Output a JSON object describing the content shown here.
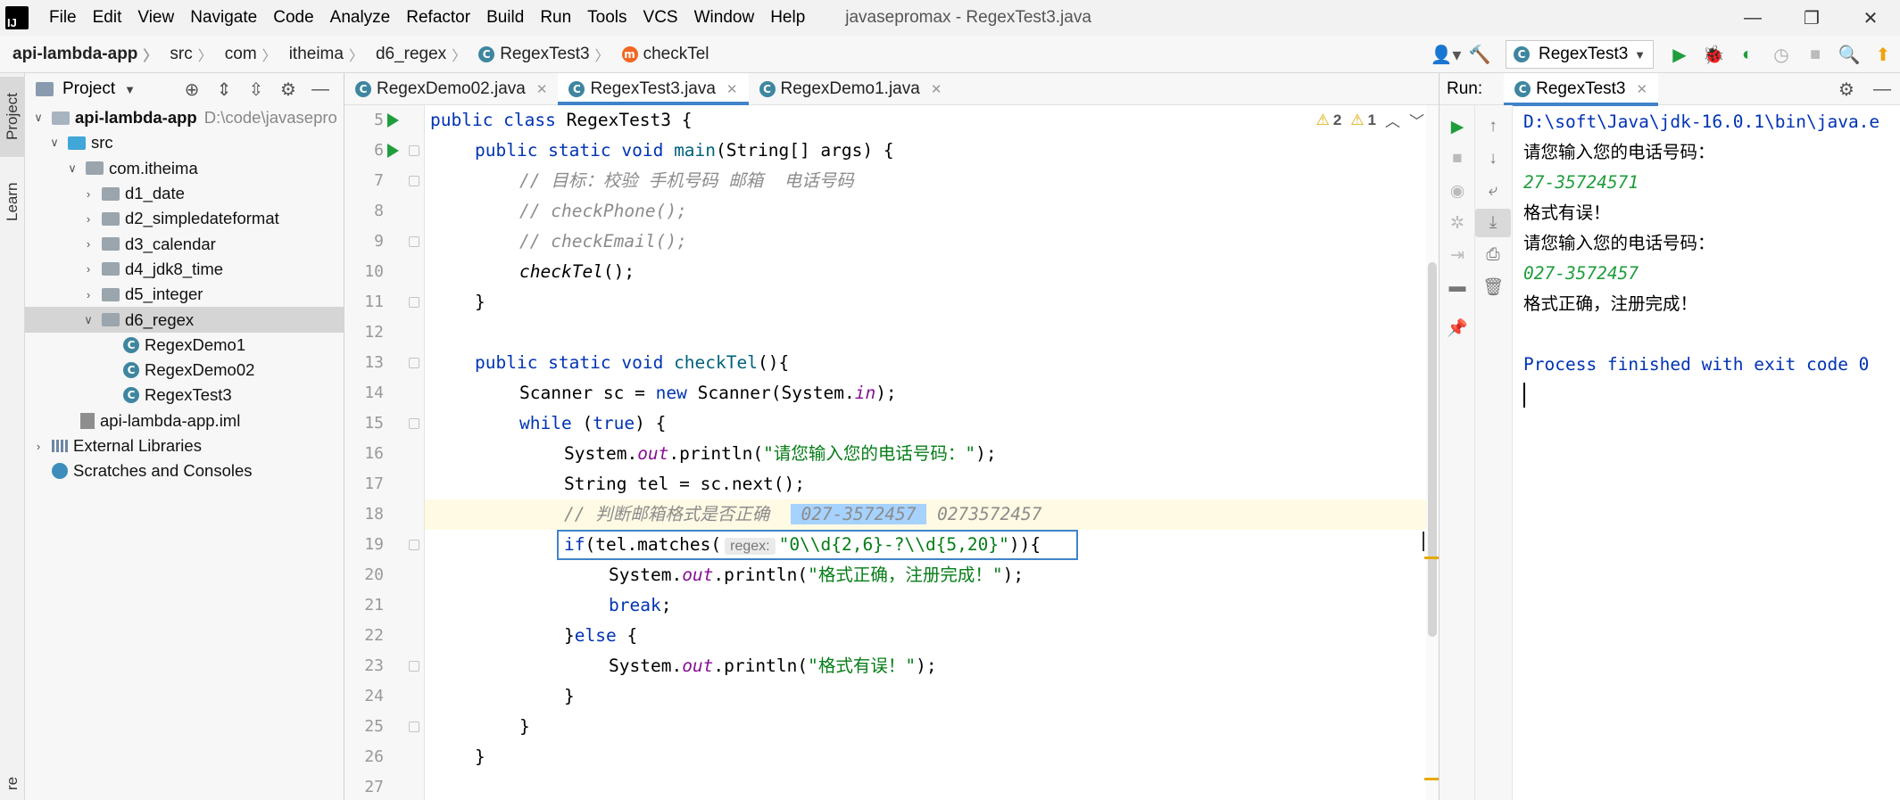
{
  "menubar": {
    "items": [
      "File",
      "Edit",
      "View",
      "Navigate",
      "Code",
      "Analyze",
      "Refactor",
      "Build",
      "Run",
      "Tools",
      "VCS",
      "Window",
      "Help"
    ],
    "window_title": "javasepromax - RegexTest3.java",
    "min": "—",
    "restore": "❐",
    "close": "✕"
  },
  "navbar": {
    "crumbs": [
      "api-lambda-app",
      "src",
      "com",
      "itheima",
      "d6_regex",
      "RegexTest3",
      "checkTel"
    ],
    "run_config": "RegexTest3"
  },
  "left_strip": {
    "project_tab": "Project",
    "learn_tab": "Learn",
    "bottom_tab": "re"
  },
  "project": {
    "title": "Project",
    "tree": [
      {
        "label": "api-lambda-app",
        "extra": "D:\\code\\javasepro",
        "kind": "module"
      },
      {
        "label": "src",
        "kind": "src"
      },
      {
        "label": "com.itheima",
        "kind": "pkg"
      },
      {
        "label": "d1_date",
        "kind": "pkg"
      },
      {
        "label": "d2_simpledateformat",
        "kind": "pkg"
      },
      {
        "label": "d3_calendar",
        "kind": "pkg"
      },
      {
        "label": "d4_jdk8_time",
        "kind": "pkg"
      },
      {
        "label": "d5_integer",
        "kind": "pkg"
      },
      {
        "label": "d6_regex",
        "kind": "pkg",
        "selected": true
      },
      {
        "label": "RegexDemo1",
        "kind": "class"
      },
      {
        "label": "RegexDemo02",
        "kind": "class"
      },
      {
        "label": "RegexTest3",
        "kind": "class"
      },
      {
        "label": "api-lambda-app.iml",
        "kind": "iml"
      },
      {
        "label": "External Libraries",
        "kind": "lib"
      },
      {
        "label": "Scratches and Consoles",
        "kind": "scratch"
      }
    ]
  },
  "editor": {
    "tabs": [
      {
        "label": "RegexDemo02.java",
        "active": false
      },
      {
        "label": "RegexTest3.java",
        "active": true
      },
      {
        "label": "RegexDemo1.java",
        "active": false
      }
    ],
    "warnings": {
      "warn_count": "2",
      "weak_count": "1"
    },
    "line_numbers": [
      "5",
      "6",
      "7",
      "8",
      "9",
      "10",
      "11",
      "12",
      "13",
      "14",
      "15",
      "16",
      "17",
      "18",
      "19",
      "20",
      "21",
      "22",
      "23",
      "24",
      "25",
      "26",
      "27"
    ],
    "code": {
      "l5_kw": "public class ",
      "l5_rest": "RegexTest3 {",
      "l6_kw": "public static void ",
      "l6_fn": "main",
      "l6_rest": "(String[] args) {",
      "l7": "// 目标：校验 手机号码 邮箱  电话号码",
      "l8": "// checkPhone();",
      "l9": "// checkEmail();",
      "l10_call": "checkTel",
      "l10_rest": "();",
      "l11": "}",
      "l13_kw": "public static void ",
      "l13_fn": "checkTel",
      "l13_rest": "(){",
      "l14_a": "Scanner sc = ",
      "l14_kw": "new",
      "l14_b": " Scanner(System.",
      "l14_fld": "in",
      "l14_c": ");",
      "l15_kw": "while",
      "l15_a": " (",
      "l15_kw2": "true",
      "l15_b": ") {",
      "l16_a": "System.",
      "l16_fld": "out",
      "l16_b": ".println(",
      "l16_str": "\"请您输入您的电话号码：\"",
      "l16_c": ");",
      "l17": "String tel = sc.next();",
      "l18_cmt": "// 判断邮箱格式是否正确  ",
      "l18_sel": " 027-3572457 ",
      "l18_rest": " 0273572457",
      "l19_kw": "if",
      "l19_a": "(tel.matches(",
      "l19_inlay": "regex:",
      "l19_str": "\"0\\\\d{2,6}-?\\\\d{5,20}\"",
      "l19_b": ")){",
      "l20_a": "System.",
      "l20_fld": "out",
      "l20_b": ".println(",
      "l20_str": "\"格式正确，注册完成！\"",
      "l20_c": ");",
      "l21_kw": "break",
      "l21_rest": ";",
      "l22_a": "}",
      "l22_kw": "else",
      "l22_b": " {",
      "l23_a": "System.",
      "l23_fld": "out",
      "l23_b": ".println(",
      "l23_str": "\"格式有误！\"",
      "l23_c": ");",
      "l24": "}",
      "l25": "}",
      "l26": "}"
    }
  },
  "run_panel": {
    "label": "Run:",
    "tab": "RegexTest3",
    "console": [
      {
        "text": "D:\\soft\\Java\\jdk-16.0.1\\bin\\java.e",
        "kind": "sys"
      },
      {
        "text": "请您输入您的电话号码：",
        "kind": "out"
      },
      {
        "text": "27-35724571",
        "kind": "in"
      },
      {
        "text": "格式有误！",
        "kind": "out"
      },
      {
        "text": "请您输入您的电话号码：",
        "kind": "out"
      },
      {
        "text": "027-3572457",
        "kind": "in"
      },
      {
        "text": "格式正确，注册完成！",
        "kind": "out"
      },
      {
        "text": "",
        "kind": "out"
      },
      {
        "text": "Process finished with exit code 0",
        "kind": "sys"
      }
    ]
  },
  "colors": {
    "accent": "#4083c9",
    "run_green": "#1f9d3c",
    "keyword": "#0033b3",
    "string": "#067d17",
    "comment": "#8c8c8c",
    "field": "#871094",
    "warning": "#e0a800"
  }
}
